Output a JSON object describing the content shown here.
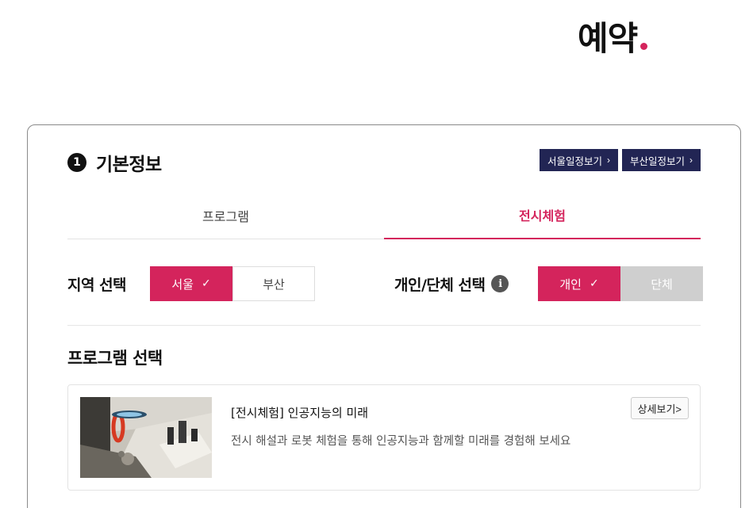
{
  "header": {
    "title": "예약"
  },
  "section": {
    "step": "1",
    "title": "기본정보",
    "schedule_buttons": [
      {
        "label": "서울일정보기",
        "chevron": "›"
      },
      {
        "label": "부산일정보기",
        "chevron": "›"
      }
    ]
  },
  "tabs": [
    {
      "label": "프로그램",
      "active": false
    },
    {
      "label": "전시체험",
      "active": true
    }
  ],
  "region": {
    "label": "지역 선택",
    "options": [
      {
        "label": "서울",
        "selected": true,
        "check": "✓"
      },
      {
        "label": "부산",
        "selected": false
      }
    ]
  },
  "group_type": {
    "label": "개인/단체 선택",
    "info_icon": "i",
    "options": [
      {
        "label": "개인",
        "selected": true,
        "check": "✓"
      },
      {
        "label": "단체",
        "selected": false
      }
    ]
  },
  "program_select": {
    "title": "프로그램 선택",
    "items": [
      {
        "title": "[전시체험] 인공지능의 미래",
        "description": "전시 해설과 로봇 체험을 통해 인공지능과 함께할 미래를 경험해 보세요",
        "detail_label": "상세보기>"
      }
    ]
  },
  "colors": {
    "accent": "#d4245c",
    "navy": "#222554",
    "disabled": "#cfcfcf"
  }
}
